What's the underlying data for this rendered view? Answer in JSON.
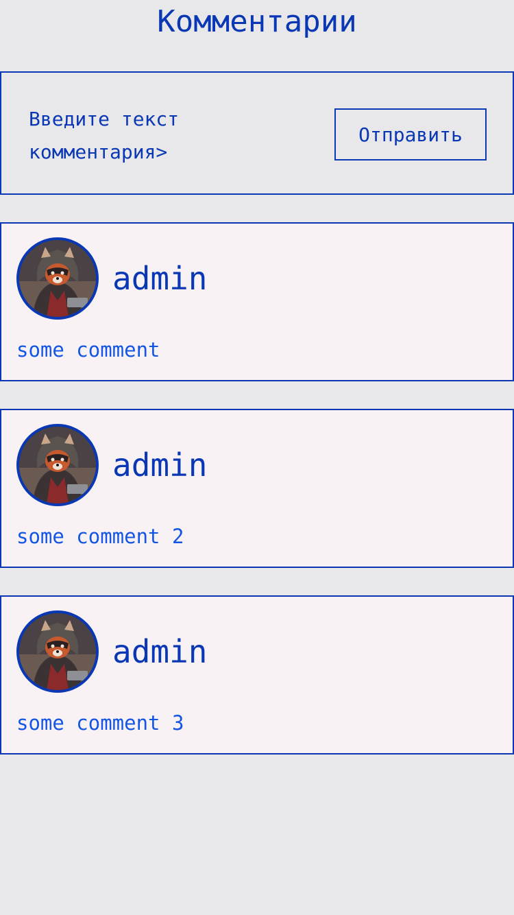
{
  "page": {
    "title": "Комментарии"
  },
  "composer": {
    "placeholder": "Введите текст комментария>",
    "send_label": "Отправить"
  },
  "comments": [
    {
      "author": "admin",
      "text": "some comment"
    },
    {
      "author": "admin",
      "text": "some comment 2"
    },
    {
      "author": "admin",
      "text": "some comment 3"
    }
  ],
  "colors": {
    "accent": "#0a37b4",
    "comment_text": "#1555e6",
    "page_background": "#e8e8eb",
    "card_background": "#f8f2f4"
  }
}
